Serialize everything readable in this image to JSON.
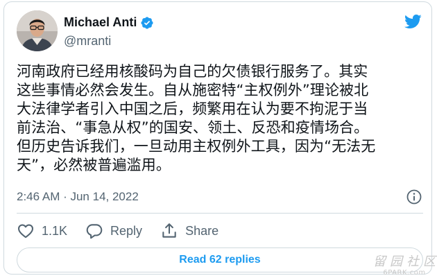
{
  "author": {
    "name": "Michael Anti",
    "handle": "@mranti",
    "verified": true
  },
  "tweet": {
    "lines": [
      "河南政府已经用核酸码为自己的欠债银行服务了。其实",
      "这些事情必然会发生。自从施密特“主权例外”理论被北",
      "大法律学者引入中国之后，频繁用在认为要不拘泥于当",
      "前法治、“事急从权”的国安、领土、反恐和疫情场合。",
      "但历史告诉我们，一旦动用主权例外工具，因为“无法无",
      "天”，必然被普遍滥用。"
    ],
    "timestamp": "2:46 AM · Jun 14, 2022"
  },
  "actions": {
    "like_count": "1.1K",
    "reply_label": "Reply",
    "share_label": "Share"
  },
  "read_replies_label": "Read 62 replies",
  "watermark": {
    "cn": "留园社区",
    "en": "6PARK.com"
  },
  "icons": {
    "verified": "verified-badge-icon",
    "brand": "twitter-bird-icon",
    "info": "info-icon",
    "like": "heart-icon",
    "reply": "reply-icon",
    "share": "share-icon"
  },
  "colors": {
    "accent": "#1d9bf0",
    "text_primary": "#0f1419",
    "text_secondary": "#536471",
    "border": "#cfd9de"
  }
}
